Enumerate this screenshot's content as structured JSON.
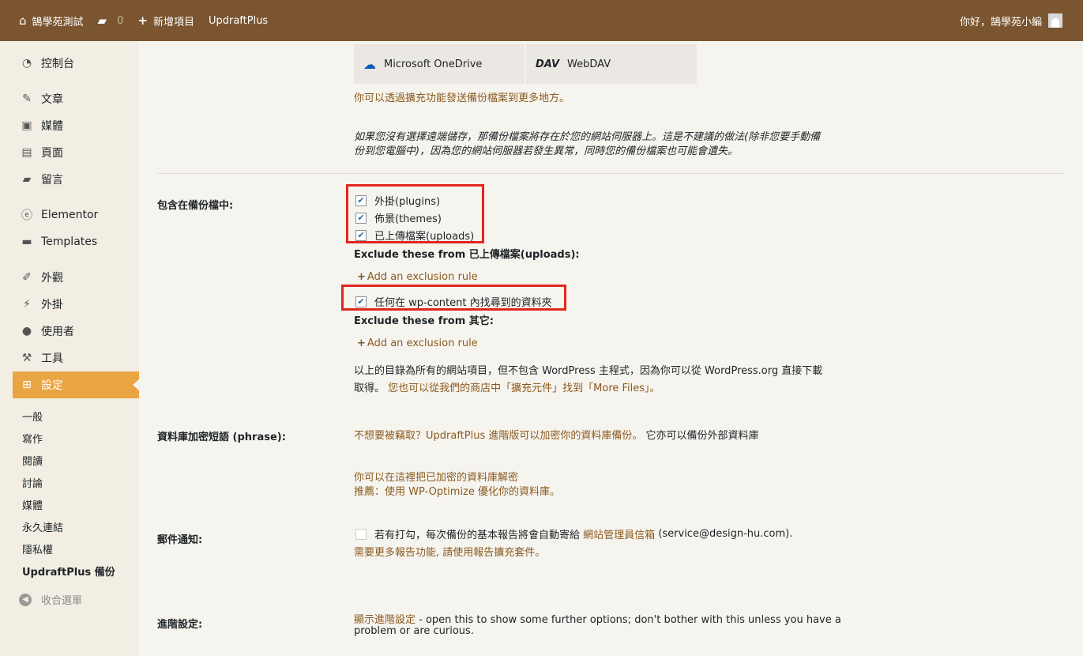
{
  "adminbar": {
    "site_name": "鵠學苑測試",
    "comments_count": "0",
    "new_label": "新增項目",
    "plugin_label": "UpdraftPlus",
    "greeting": "你好，鵠學苑小編"
  },
  "sidebar": {
    "items": [
      {
        "label": "控制台",
        "icon": "dashboard-icon"
      },
      {
        "label": "文章",
        "icon": "pin-icon"
      },
      {
        "label": "媒體",
        "icon": "media-icon"
      },
      {
        "label": "頁面",
        "icon": "page-icon"
      },
      {
        "label": "留言",
        "icon": "comment-icon"
      },
      {
        "label": "Elementor",
        "icon": "elementor-icon"
      },
      {
        "label": "Templates",
        "icon": "folder-icon"
      },
      {
        "label": "外觀",
        "icon": "brush-icon"
      },
      {
        "label": "外掛",
        "icon": "plugin-icon"
      },
      {
        "label": "使用者",
        "icon": "user-icon"
      },
      {
        "label": "工具",
        "icon": "wrench-icon"
      },
      {
        "label": "設定",
        "icon": "settings-icon"
      }
    ],
    "subitems": [
      "一般",
      "寫作",
      "閱讀",
      "討論",
      "媒體",
      "永久連結",
      "隱私權",
      "UpdraftPlus 備份"
    ],
    "collapse_label": "收合選單"
  },
  "main": {
    "dest_onedrive": "Microsoft OneDrive",
    "dest_webdav": "WebDAV",
    "more_dest_text": "你可以透過擴充功能發送備份檔案到更多地方。",
    "warning_line1": "如果您沒有選擇遠端儲存，那備份檔案將存在於您的網站伺服器上。這是不建議的做法(除非您要手動備",
    "warning_line2": "份到您電腦中)，因為您的網站伺服器若發生異常，同時您的備份檔案也可能會遺失。",
    "include_label": "包含在備份檔中:",
    "cb_plugins": "外掛(plugins)",
    "cb_themes": "佈景(themes)",
    "cb_uploads": "已上傳檔案(uploads)",
    "exclude_uploads_label": "Exclude these from 已上傳檔案(uploads):",
    "add_exclusion": "Add an exclusion rule",
    "cb_wpcontent": "任何在 wp-content 內找尋到的資料夾",
    "exclude_other_label": "Exclude these from 其它:",
    "dirs_note_line1": "以上的目錄為所有的網站項目，但不包含 WordPress 主程式，因為你可以從 WordPress.org 直接下載",
    "dirs_note_line2_plain": "取得。",
    "dirs_note_line2_link": "您也可以從我們的商店中「擴充元件」找到「More Files」。",
    "db_phrase_label": "資料庫加密短語 (phrase):",
    "db_phrase_link": "不想要被竊取？UpdraftPlus 進階版可以加密你的資料庫備份。",
    "db_phrase_extra": "它亦可以備份外部資料庫",
    "decrypt_link": "你可以在這裡把已加密的資料庫解密",
    "wpoptimize_link": "推薦：使用 WP-Optimize 優化你的資料庫。",
    "email_label": "郵件通知:",
    "email_text_pre": "若有打勾，每次備份的基本報告將會自動寄給",
    "email_link": "網站管理員信箱",
    "email_addr": "(service@design-hu.com).",
    "email_more_link": "需要更多報告功能, 請使用報告擴充套件。",
    "advanced_label": "進階設定:",
    "advanced_link": "顯示進階設定",
    "advanced_text1": " - open this to show some further options; don't bother with this unless you have a",
    "advanced_text2": "problem or are curious."
  },
  "colors": {
    "adminbar": "#7a5530",
    "accent": "#e9a444",
    "link": "#8b5a20",
    "highlight": "#e2261d"
  }
}
